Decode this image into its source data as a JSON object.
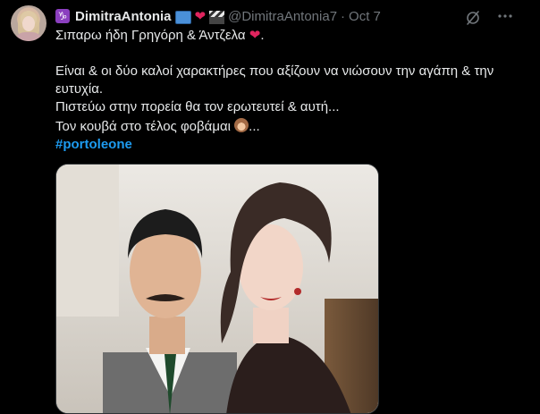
{
  "author": {
    "name": "DimitraAntonia",
    "handle": "@DimitraAntonia7",
    "separator": "·",
    "time": "Oct 7",
    "badges": [
      "zodiac-icon",
      "tv-icon",
      "red-heart-icon",
      "clapper-icon"
    ]
  },
  "tweet": {
    "line1": "Σιπαρω ήδη Γρηγόρη & Άντζελα",
    "line2": "Είναι & οι δύο καλοί χαρακτήρες που αξίζουν να νιώσουν την αγάπη & την ευτυχία.",
    "line3": "Πιστεύω στην πορεία θα τον ερωτευτεί & αυτή...",
    "line4": "Τον κουβά στο τέλος φοβάμαι",
    "line4_suffix": "...",
    "hashtag": "#portoleone"
  },
  "actions": {
    "grok": "grok-icon",
    "more": "more-icon"
  },
  "colors": {
    "background": "#000000",
    "text": "#e7e9ea",
    "muted": "#71767b",
    "link": "#1d9bf0",
    "heart": "#e0245e"
  }
}
